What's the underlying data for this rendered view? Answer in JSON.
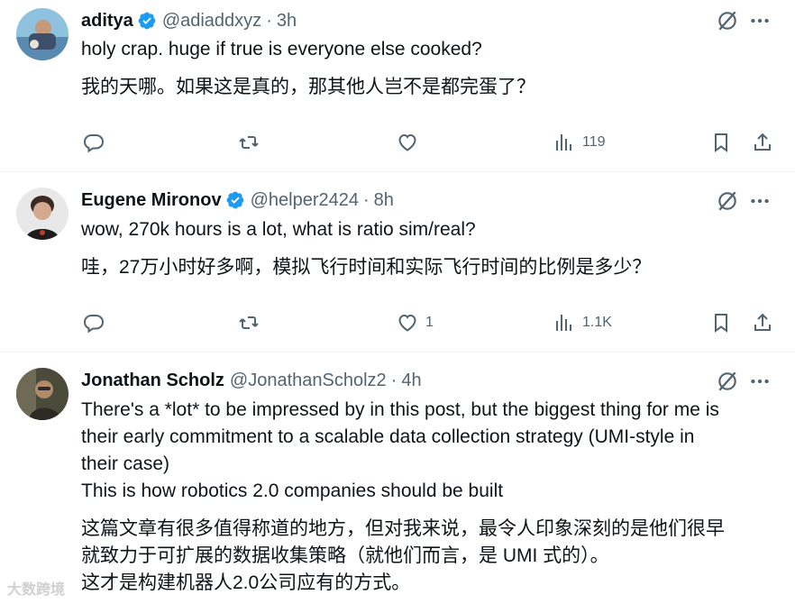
{
  "tweets": [
    {
      "name": "aditya",
      "handle": "@adiaddxyz",
      "dot": "·",
      "time": "3h",
      "line1": "holy crap. huge if true is everyone else cooked?",
      "line2": "我的天哪。如果这是真的，那其他人岂不是都完蛋了？",
      "views": "119",
      "likes": ""
    },
    {
      "name": "Eugene Mironov",
      "handle": "@helper2424",
      "dot": "·",
      "time": "8h",
      "line1": "wow, 270k hours is a lot, what is ratio sim/real?",
      "line2": "哇，27万小时好多啊，模拟飞行时间和实际飞行时间的比例是多少？",
      "views": "1.1K",
      "likes": "1"
    },
    {
      "name": "Jonathan Scholz",
      "handle": "@JonathanScholz2",
      "dot": "·",
      "time": "4h",
      "en1": "There's a *lot* to be impressed by in this post, but the biggest thing for me is",
      "en2": "their early commitment to a scalable data collection strategy (UMI-style in",
      "en3": "their case)",
      "en4": "This is how robotics 2.0 companies should be built",
      "zh1": "这篇文章有很多值得称道的地方，但对我来说，最令人印象深刻的是他们很早",
      "zh2": "就致力于可扩展的数据收集策略（就他们而言，是 UMI 式的）。",
      "zh3": "这才是构建机器人2.0公司应有的方式。"
    }
  ],
  "watermark": "大数跨境",
  "colors": {
    "verified": "#1d9bf0",
    "muted": "#536471",
    "text": "#0f1419"
  }
}
